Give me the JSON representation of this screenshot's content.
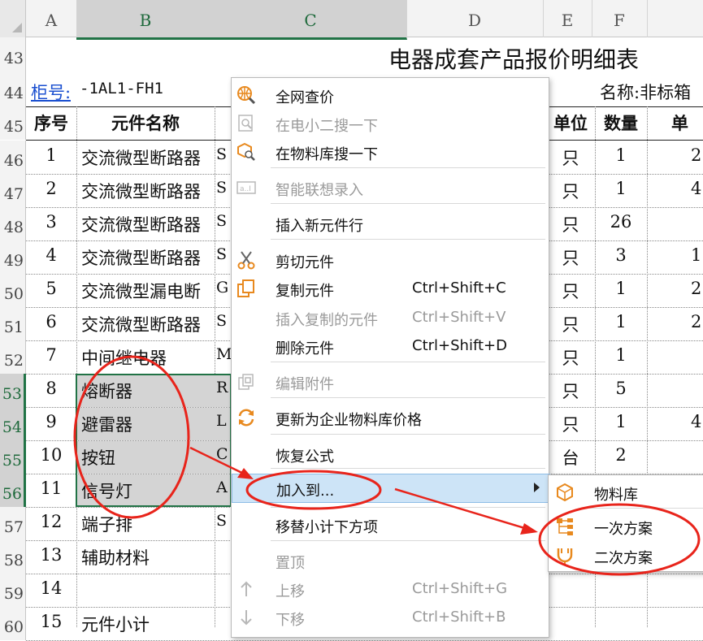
{
  "sheet": {
    "columns": [
      "A",
      "B",
      "C",
      "D",
      "E",
      "F"
    ],
    "title": "电器成套产品报价明细表",
    "cabinet_link": "柜号:",
    "cabinet_value": "-1AL1-FH1",
    "name_label": "名称:非标箱",
    "headers": {
      "seq": "序号",
      "name": "元件名称",
      "unit": "单位",
      "qty": "数量",
      "price": "单"
    },
    "row_numbers": [
      "43",
      "44",
      "45",
      "46",
      "47",
      "48",
      "49",
      "50",
      "51",
      "52",
      "53",
      "54",
      "55",
      "56",
      "57",
      "58",
      "59",
      "60"
    ],
    "rows": [
      {
        "seq": "1",
        "name": "交流微型断路器",
        "model": "S",
        "unit": "只",
        "qty": "1",
        "price": "2"
      },
      {
        "seq": "2",
        "name": "交流微型断路器",
        "model": "S",
        "unit": "只",
        "qty": "1",
        "price": "4"
      },
      {
        "seq": "3",
        "name": "交流微型断路器",
        "model": "S",
        "unit": "只",
        "qty": "26",
        "price": ""
      },
      {
        "seq": "4",
        "name": "交流微型断路器",
        "model": "S",
        "unit": "只",
        "qty": "3",
        "price": "1"
      },
      {
        "seq": "5",
        "name": "交流微型漏电断",
        "model": "G",
        "unit": "只",
        "qty": "1",
        "price": "2"
      },
      {
        "seq": "6",
        "name": "交流微型断路器",
        "model": "S",
        "unit": "只",
        "qty": "1",
        "price": "2"
      },
      {
        "seq": "7",
        "name": "中间继电器",
        "model": "M",
        "unit": "只",
        "qty": "1",
        "price": ""
      },
      {
        "seq": "8",
        "name": "熔断器",
        "model": "R",
        "unit": "只",
        "qty": "5",
        "price": ""
      },
      {
        "seq": "9",
        "name": "避雷器",
        "model": "L",
        "unit": "只",
        "qty": "1",
        "price": "4"
      },
      {
        "seq": "10",
        "name": "按钮",
        "model": "C",
        "unit": "台",
        "qty": "2",
        "price": ""
      },
      {
        "seq": "11",
        "name": "信号灯",
        "model": "A",
        "unit": "",
        "qty": "",
        "price": ""
      },
      {
        "seq": "12",
        "name": "端子排",
        "model": "S",
        "unit": "",
        "qty": "",
        "price": ""
      },
      {
        "seq": "13",
        "name": "辅助材料",
        "model": "",
        "unit": "",
        "qty": "",
        "price": ""
      },
      {
        "seq": "14",
        "name": "",
        "model": "",
        "unit": "",
        "qty": "",
        "price": ""
      },
      {
        "seq": "15",
        "name": "元件小计",
        "model": "",
        "unit": "",
        "qty": "",
        "price": ""
      }
    ]
  },
  "context_menu": {
    "items": [
      {
        "label": "全网查价",
        "shortcut": "",
        "icon": "globe-search-icon",
        "disabled": false
      },
      {
        "label": "在电小二搜一下",
        "shortcut": "",
        "icon": "search-doc-icon",
        "disabled": true
      },
      {
        "label": "在物料库搜一下",
        "shortcut": "",
        "icon": "box-search-icon",
        "disabled": false
      },
      {
        "label": "智能联想录入",
        "shortcut": "",
        "icon": "input-box-icon",
        "disabled": true
      },
      {
        "label": "插入新元件行",
        "shortcut": "",
        "icon": "",
        "disabled": false
      },
      {
        "label": "剪切元件",
        "shortcut": "",
        "icon": "scissors-icon",
        "disabled": false
      },
      {
        "label": "复制元件",
        "shortcut": "Ctrl+Shift+C",
        "icon": "copy-icon",
        "disabled": false
      },
      {
        "label": "插入复制的元件",
        "shortcut": "Ctrl+Shift+V",
        "icon": "",
        "disabled": true
      },
      {
        "label": "删除元件",
        "shortcut": "Ctrl+Shift+D",
        "icon": "",
        "disabled": false
      },
      {
        "label": "编辑附件",
        "shortcut": "",
        "icon": "attachment-icon",
        "disabled": true
      },
      {
        "label": "更新为企业物料库价格",
        "shortcut": "",
        "icon": "refresh-icon",
        "disabled": false
      },
      {
        "label": "恢复公式",
        "shortcut": "",
        "icon": "",
        "disabled": false
      },
      {
        "label": "加入到...",
        "shortcut": "",
        "icon": "",
        "disabled": false
      },
      {
        "label": "移替小计下方项",
        "shortcut": "",
        "icon": "",
        "disabled": false
      },
      {
        "label": "置顶",
        "shortcut": "",
        "icon": "",
        "disabled": true
      },
      {
        "label": "上移",
        "shortcut": "Ctrl+Shift+G",
        "icon": "arrow-up-icon",
        "disabled": true
      },
      {
        "label": "下移",
        "shortcut": "Ctrl+Shift+B",
        "icon": "arrow-down-icon",
        "disabled": true
      }
    ],
    "submenu": [
      {
        "label": "物料库",
        "icon": "box-icon"
      },
      {
        "label": "一次方案",
        "icon": "tree-icon"
      },
      {
        "label": "二次方案",
        "icon": "plug-icon"
      }
    ]
  },
  "colors": {
    "annotation": "#e8241b",
    "highlight": "#cde4f7",
    "selection": "#217346",
    "icon": "#e8891e"
  }
}
